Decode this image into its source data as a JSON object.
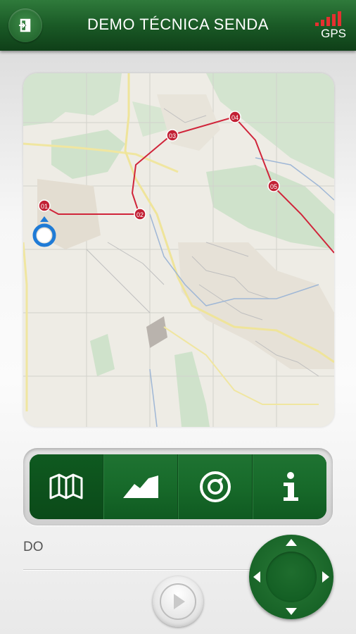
{
  "header": {
    "title": "DEMO TÉCNICA SENDA",
    "gps_label": "GPS",
    "exit_icon": "exit-icon",
    "gps_icon": "signal-bars-icon"
  },
  "map": {
    "waypoints": [
      "01",
      "02",
      "03",
      "04",
      "05"
    ],
    "route_color": "#d0243a",
    "location_marker": "location-marker-icon"
  },
  "toolbar": {
    "tabs": [
      {
        "icon": "map-icon",
        "active": true
      },
      {
        "icon": "elevation-profile-icon",
        "active": false
      },
      {
        "icon": "compass-target-icon",
        "active": false
      },
      {
        "icon": "info-icon",
        "active": false
      }
    ]
  },
  "bottom": {
    "route_label": "DO",
    "play_icon": "play-icon",
    "dpad_icon": "direction-pad-icon"
  },
  "colors": {
    "brand_green": "#1a5a26",
    "route_red": "#d0243a"
  }
}
